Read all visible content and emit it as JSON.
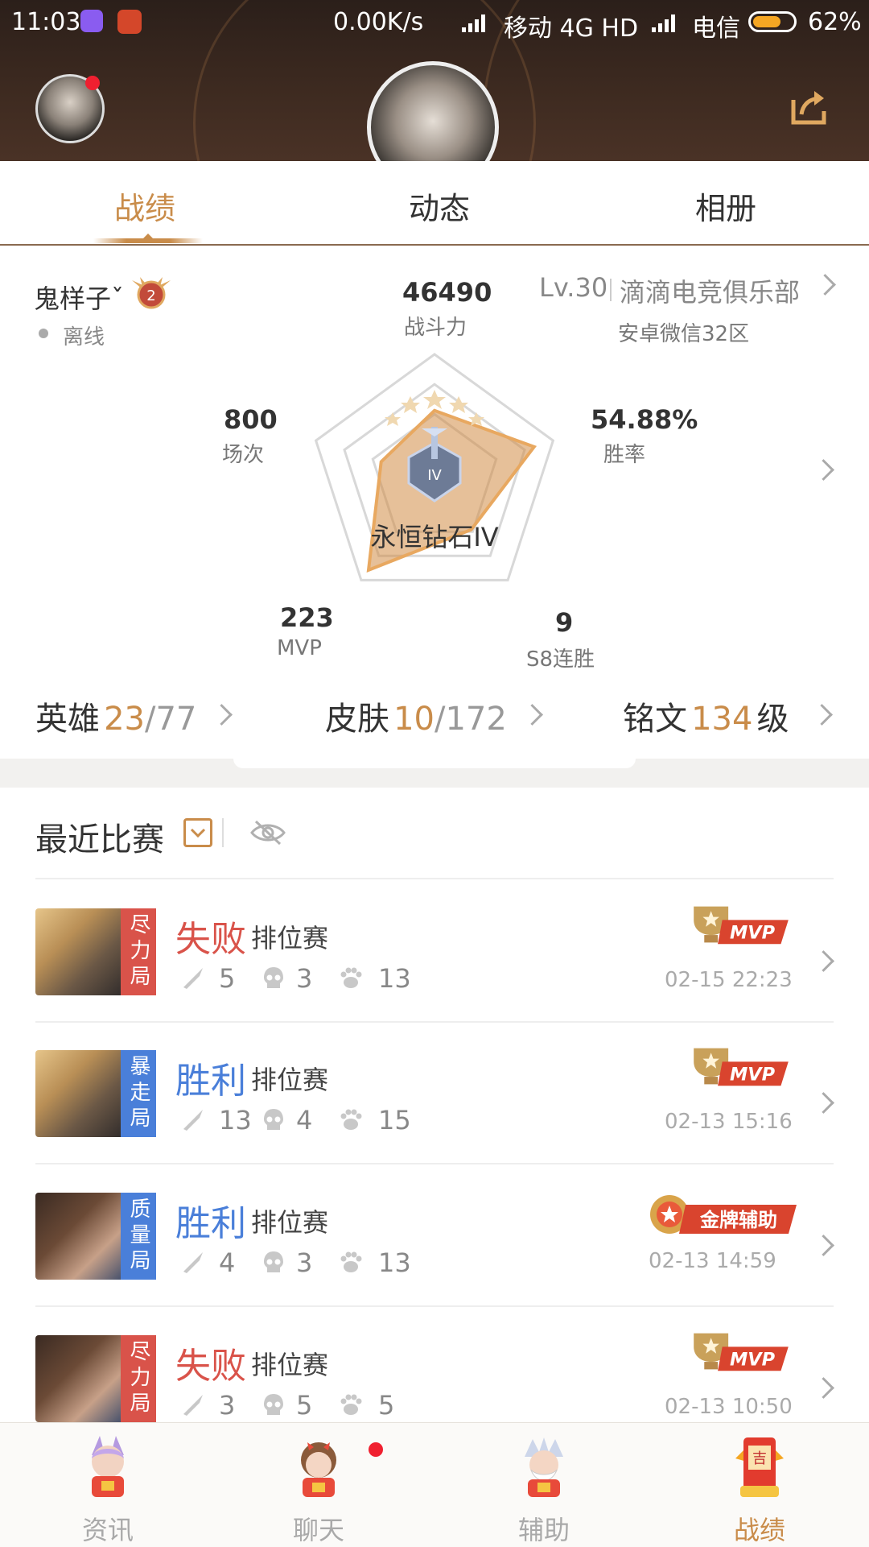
{
  "status_bar": {
    "time": "11:03",
    "net_speed": "0.00K/s",
    "carrier1": "移动 4G HD",
    "carrier2": "电信",
    "battery": "62%"
  },
  "tabs": [
    {
      "label": "战绩",
      "active": true
    },
    {
      "label": "动态",
      "active": false
    },
    {
      "label": "相册",
      "active": false
    }
  ],
  "profile": {
    "name": "鬼样子ˇ",
    "rank_badge": "2",
    "online_status": "离线",
    "level": "Lv.30",
    "club": "滴滴电竞俱乐部",
    "server": "安卓微信32区"
  },
  "radar": {
    "power_value": "46490",
    "power_label": "战斗力",
    "matches_value": "800",
    "matches_label": "场次",
    "winrate_value": "54.88%",
    "winrate_label": "胜率",
    "mvp_value": "223",
    "mvp_label": "MVP",
    "streak_value": "9",
    "streak_label": "S8连胜",
    "rank_name": "永恒钻石IV",
    "rank_emblem_text": "IV",
    "levels": {
      "power": 0.55,
      "winrate": 0.84,
      "streak": 0.5,
      "mvp": 0.9,
      "matches": 0.45
    }
  },
  "collection": {
    "heroes_label": "英雄",
    "heroes_owned": "23",
    "heroes_total": "/77",
    "skins_label": "皮肤",
    "skins_owned": "10",
    "skins_total": "/172",
    "runes_label": "铭文",
    "runes_level": "134",
    "runes_unit": "级"
  },
  "recent": {
    "title": "最近比赛",
    "matches": [
      {
        "badge": "尽力局",
        "badge_color": "#d9534a",
        "result": "失败",
        "result_color": "#d9534a",
        "mode": "排位赛",
        "kills": "5",
        "deaths": "3",
        "assists": "13",
        "award": "MVP",
        "date": "02-15 22:23",
        "hero": "blond"
      },
      {
        "badge": "暴走局",
        "badge_color": "#4a7fd9",
        "result": "胜利",
        "result_color": "#4a7fd9",
        "mode": "排位赛",
        "kills": "13",
        "deaths": "4",
        "assists": "15",
        "award": "MVP",
        "date": "02-13 15:16",
        "hero": "blond"
      },
      {
        "badge": "质量局",
        "badge_color": "#4a7fd9",
        "result": "胜利",
        "result_color": "#4a7fd9",
        "mode": "排位赛",
        "kills": "4",
        "deaths": "3",
        "assists": "13",
        "award": "金牌辅助",
        "date": "02-13 14:59",
        "hero": "dark"
      },
      {
        "badge": "尽力局",
        "badge_color": "#d9534a",
        "result": "失败",
        "result_color": "#d9534a",
        "mode": "排位赛",
        "kills": "3",
        "deaths": "5",
        "assists": "5",
        "award": "MVP",
        "date": "02-13 10:50",
        "hero": "dark"
      }
    ]
  },
  "bottom_nav": [
    {
      "label": "资讯",
      "active": false,
      "dot": false
    },
    {
      "label": "聊天",
      "active": false,
      "dot": true
    },
    {
      "label": "辅助",
      "active": false,
      "dot": false
    },
    {
      "label": "战绩",
      "active": true,
      "dot": false
    }
  ],
  "colors": {
    "accent": "#c98c4a",
    "win": "#4a7fd9",
    "lose": "#d9534a"
  }
}
